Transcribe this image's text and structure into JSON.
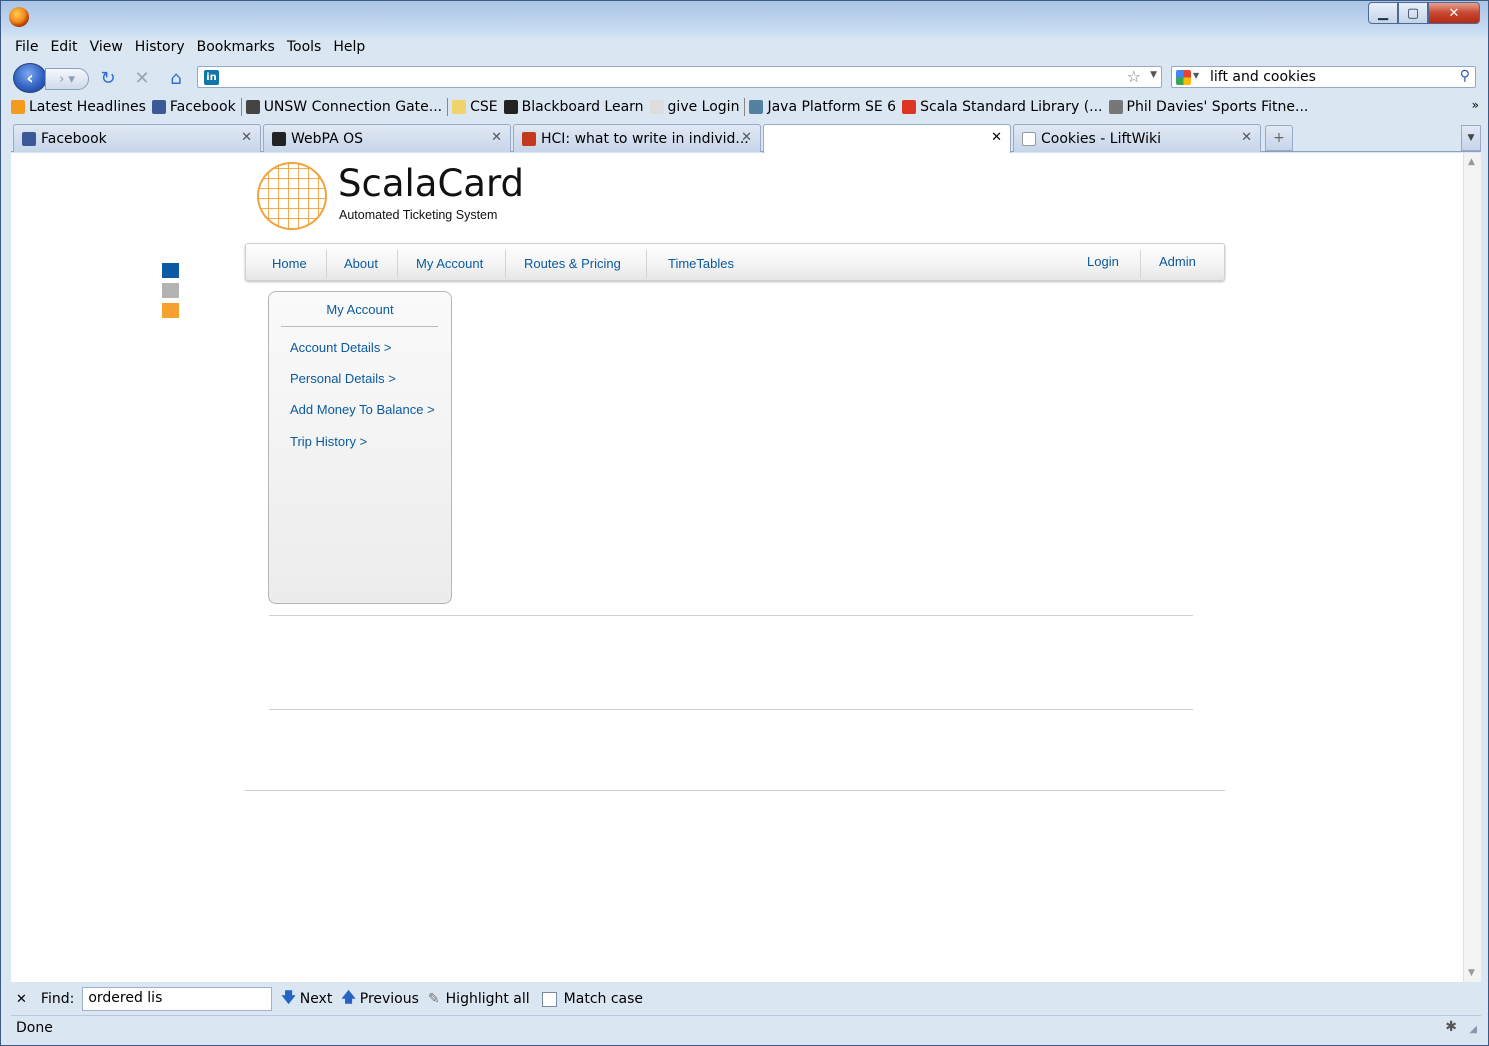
{
  "browser": {
    "menus": [
      "File",
      "Edit",
      "View",
      "History",
      "Bookmarks",
      "Tools",
      "Help"
    ],
    "search_value": "lift and cookies",
    "bookmarks": [
      {
        "label": "Latest Headlines",
        "icon": "rss-icon",
        "color": "#f29b1d"
      },
      {
        "label": "Facebook",
        "icon": "facebook-icon",
        "color": "#3b5998"
      },
      {
        "label": "UNSW Connection Gate...",
        "icon": "gateway-icon",
        "color": "#444444"
      },
      {
        "label": "CSE",
        "icon": "folder-icon",
        "color": "#f1d36b"
      },
      {
        "label": "Blackboard Learn",
        "icon": "blackboard-icon",
        "color": "#222222"
      },
      {
        "label": "give Login",
        "icon": "cse-icon",
        "color": "#dddddd"
      },
      {
        "label": "Java Platform SE 6",
        "icon": "java-icon",
        "color": "#5382a1"
      },
      {
        "label": "Scala Standard Library (...",
        "icon": "scala-icon",
        "color": "#de3423"
      },
      {
        "label": "Phil Davies' Sports Fitne...",
        "icon": "runner-icon",
        "color": "#777777"
      }
    ],
    "tabs": [
      {
        "label": "Facebook",
        "icon": "facebook-icon",
        "color": "#3b5998"
      },
      {
        "label": "WebPA OS",
        "icon": "linux-penguin-icon",
        "color": "#222222"
      },
      {
        "label": "HCI: what to write in individ...",
        "icon": "reddit-icon",
        "color": "#c43a1c"
      },
      {
        "label": "",
        "icon": "",
        "color": ""
      },
      {
        "label": "Cookies - LiftWiki",
        "icon": "page-icon",
        "color": "#ffffff"
      }
    ],
    "find": {
      "label": "Find:",
      "value": "ordered lis",
      "next": "Next",
      "previous": "Previous",
      "highlight_all": "Highlight all",
      "match_case": "Match case"
    },
    "status": "Done"
  },
  "page": {
    "title": "ScalaCard",
    "subtitle": "Automated Ticketing System",
    "swatch_colors": [
      "#0c5aa6",
      "#b3b3b3",
      "#f7a12e"
    ],
    "nav_left": [
      "Home",
      "About",
      "My Account",
      "Routes & Pricing",
      "TimeTables"
    ],
    "nav_right": [
      "Login",
      "Admin"
    ],
    "sidebar": {
      "title": "My Account",
      "links": [
        "Account Details >",
        "Personal Details >",
        "Add Money To Balance >",
        "Trip History >"
      ]
    }
  }
}
